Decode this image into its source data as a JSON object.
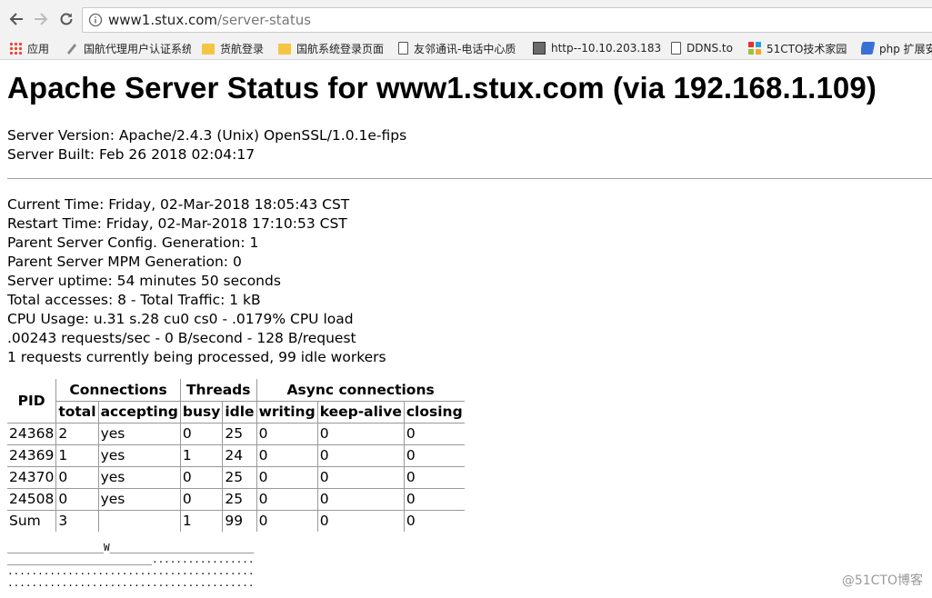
{
  "browser": {
    "url_host": "www1.stux.com",
    "url_path": "/server-status",
    "bookmarks": [
      {
        "label": "应用",
        "icon": "apps-icon"
      },
      {
        "label": "国航代理用户认证系统",
        "icon": "pen-icon"
      },
      {
        "label": "货航登录",
        "icon": "folder-icon"
      },
      {
        "label": "国航系统登录页面",
        "icon": "folder-icon"
      },
      {
        "label": "友邻通讯-电话中心质",
        "icon": "page-icon"
      },
      {
        "label": "http--10.10.203.183",
        "icon": "image-icon"
      },
      {
        "label": "DDNS.to",
        "icon": "page-icon"
      },
      {
        "label": "51CTO技术家园",
        "icon": "cto-icon"
      },
      {
        "label": "php 扩展安",
        "icon": "php-icon"
      }
    ]
  },
  "page": {
    "title": "Apache Server Status for www1.stux.com (via 192.168.1.109)",
    "server_version": "Server Version: Apache/2.4.3 (Unix) OpenSSL/1.0.1e-fips",
    "server_built": "Server Built: Feb 26 2018 02:04:17",
    "current_time": "Current Time: Friday, 02-Mar-2018 18:05:43 CST",
    "restart_time": "Restart Time: Friday, 02-Mar-2018 17:10:53 CST",
    "config_generation": "Parent Server Config. Generation: 1",
    "mpm_generation": "Parent Server MPM Generation: 0",
    "uptime": "Server uptime: 54 minutes 50 seconds",
    "accesses": "Total accesses: 8 - Total Traffic: 1 kB",
    "cpu": "CPU Usage: u.31 s.28 cu0 cs0 - .0179% CPU load",
    "rates": ".00243 requests/sec - 0 B/second - 128 B/request",
    "requests": "1 requests currently being processed, 99 idle workers"
  },
  "table": {
    "header_top": {
      "pid": "PID",
      "connections": "Connections",
      "threads": "Threads",
      "async": "Async connections"
    },
    "header_sub": [
      "total",
      "accepting",
      "busy",
      "idle",
      "writing",
      "keep-alive",
      "closing"
    ],
    "rows": [
      [
        "24368",
        "2",
        "yes",
        "0",
        "25",
        "0",
        "0",
        "0"
      ],
      [
        "24369",
        "1",
        "yes",
        "1",
        "24",
        "0",
        "0",
        "0"
      ],
      [
        "24370",
        "0",
        "yes",
        "0",
        "25",
        "0",
        "0",
        "0"
      ],
      [
        "24508",
        "0",
        "yes",
        "0",
        "25",
        "0",
        "0",
        "0"
      ],
      [
        "Sum",
        "3",
        "",
        "1",
        "99",
        "0",
        "0",
        "0"
      ]
    ]
  },
  "scoreboard": [
    "________________W________________________",
    "________________________.................",
    ".........................................",
    "........................................."
  ],
  "watermark": "@51CTO博客"
}
